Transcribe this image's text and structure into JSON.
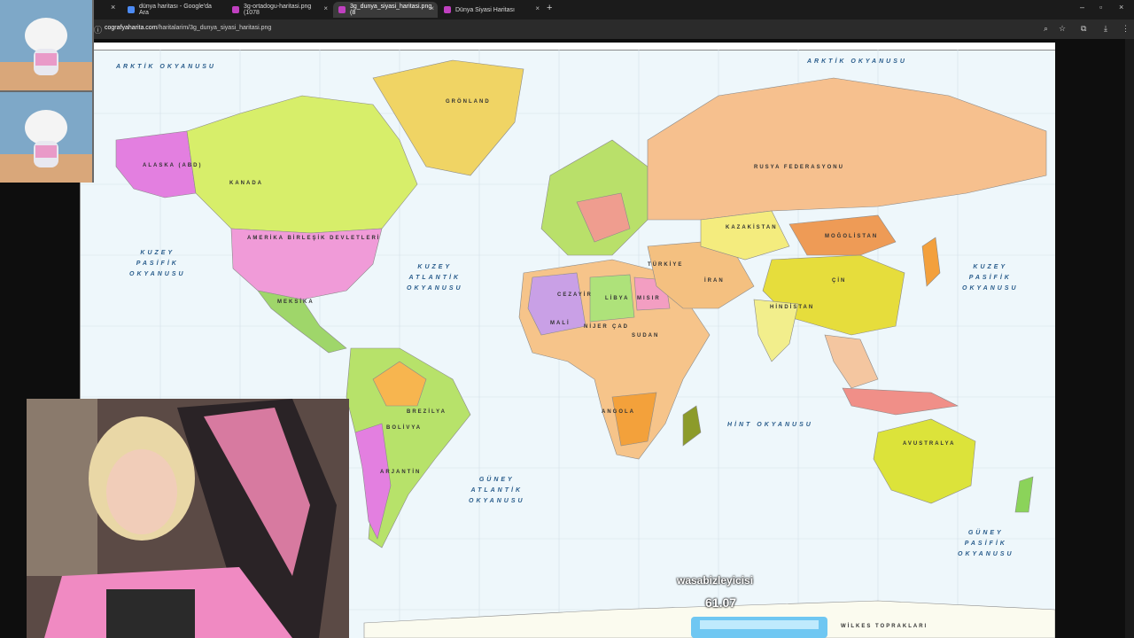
{
  "browser": {
    "tabs": [
      {
        "title": "dünya haritası - Google'da Ara",
        "active": false,
        "color": "#4c8bf5"
      },
      {
        "title": "3g-ortadogu-haritasi.png (1078",
        "active": false,
        "color": "#c040c0"
      },
      {
        "title": "3g_dunya_siyasi_haritasi.png (8",
        "active": true,
        "color": "#c040c0"
      },
      {
        "title": "Dünya Siyasi Haritası",
        "active": false,
        "color": "#c040c0"
      }
    ],
    "url_domain": "cografyaharita.com",
    "url_path": "/haritalarim/3g_dunya_siyasi_haritasi.png"
  },
  "map": {
    "oceans": {
      "arctic_left": "ARKTİK OKYANUSU",
      "arctic_right": "ARKTİK OKYANUSU",
      "north_pacific_left": "KUZEY\nPASİFİK\nOKYANUSU",
      "north_pacific_right": "KUZEY\nPASİFİK\nOKYANUSU",
      "north_atlantic": "KUZEY\nATLANTİK\nOKYANUSU",
      "south_atlantic": "GÜNEY\nATLANTİK\nOKYANUSU",
      "south_pacific": "GÜNEY\nPASİFİK\nOKYANUSU",
      "indian": "HİNT OKYANUSU"
    },
    "countries": {
      "russia": "RUSYA FEDERASYONU",
      "canada": "KANADA",
      "alaska": "ALASKA (ABD)",
      "greenland": "GRÖNLAND",
      "usa": "AMERİKA BİRLEŞİK DEVLETLERİ",
      "mexico": "MEKSİKA",
      "brazil": "BREZİLYA",
      "china": "ÇİN",
      "mongolia": "MOĞOLİSTAN",
      "kazakhstan": "KAZAKİSTAN",
      "australia": "AVUSTRALYA",
      "india": "HİNDİSTAN",
      "algeria": "CEZAYİR",
      "libya": "LİBYA",
      "egypt": "MISIR",
      "sudan": "SUDAN",
      "turkey": "TÜRKİYE",
      "iran": "İRAN",
      "angola": "ANGOLA",
      "argentina": "ARJANTİN",
      "bolivia": "BOLİVYA",
      "mali": "MALİ",
      "niger": "NİJER",
      "chad": "ÇAD",
      "antarctica": "WİLKES TOPRAKLARI"
    }
  },
  "stream_overlay": {
    "username": "wasabizleyicisi",
    "value": "61.07"
  }
}
